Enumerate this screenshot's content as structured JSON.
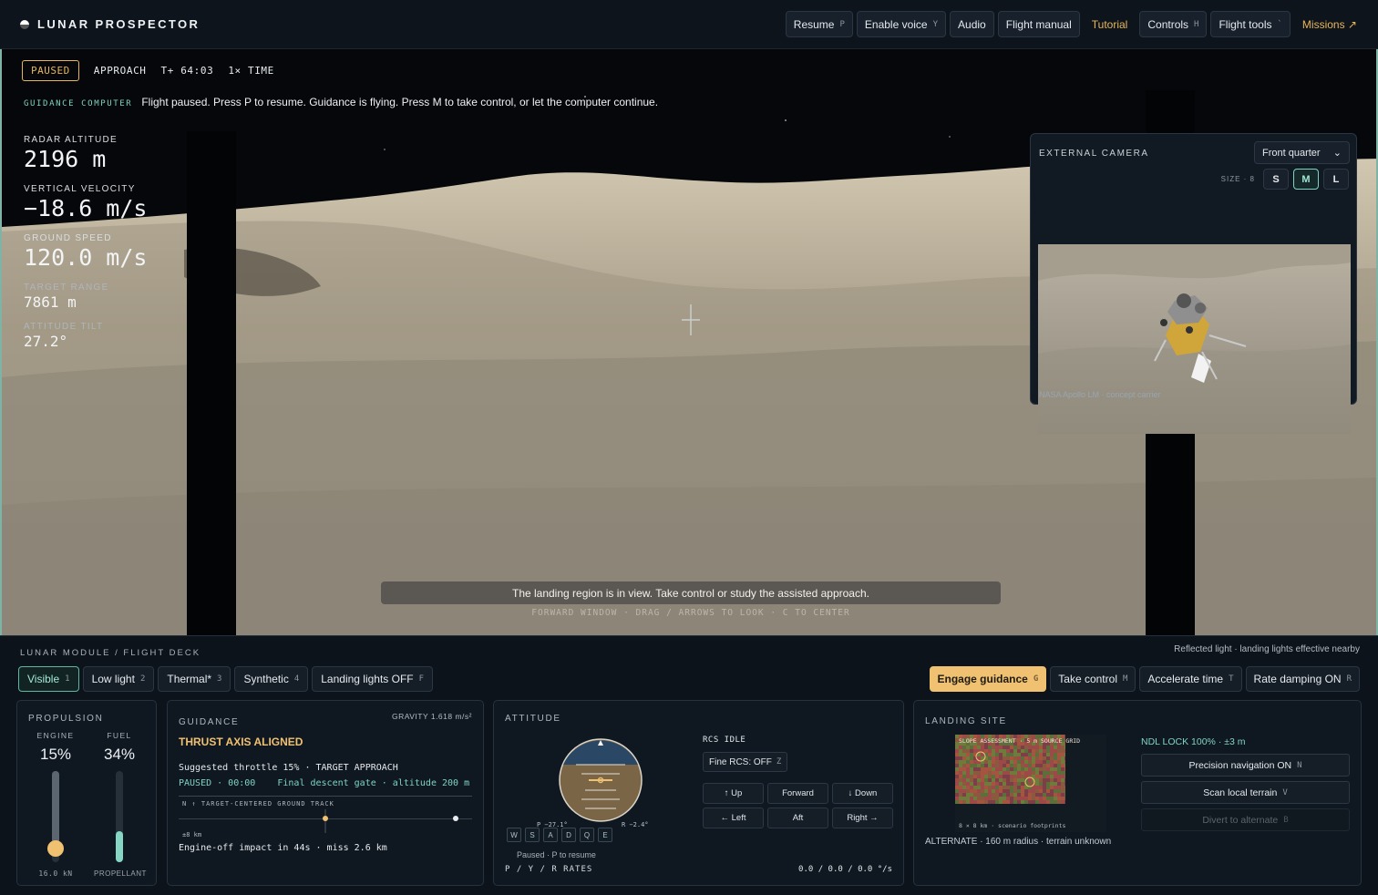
{
  "app": {
    "title": "LUNAR PROSPECTOR"
  },
  "topnav": [
    {
      "label": "Resume",
      "key": "P"
    },
    {
      "label": "Enable voice",
      "key": "Y"
    },
    {
      "label": "Audio",
      "key": ""
    },
    {
      "label": "Flight manual",
      "key": ""
    },
    {
      "label": "Tutorial",
      "key": ""
    },
    {
      "label": "Controls",
      "key": "H"
    },
    {
      "label": "Flight tools",
      "key": "`"
    },
    {
      "label": "Missions ↗",
      "key": ""
    }
  ],
  "status": {
    "badge": "PAUSED",
    "phase": "APPROACH",
    "met": "T+ 64:03",
    "timewarp": "1× TIME"
  },
  "guidance_msg": {
    "label": "GUIDANCE COMPUTER",
    "text": "Flight paused. Press P to resume. Guidance is flying. Press M to take control, or let the computer continue."
  },
  "telemetry": [
    {
      "label": "RADAR ALTITUDE",
      "value": "2196 m"
    },
    {
      "label": "VERTICAL VELOCITY",
      "value": "−18.6 m/s"
    },
    {
      "label": "GROUND SPEED",
      "value": "120.0 m/s"
    },
    {
      "label": "TARGET RANGE",
      "value": "7861 m"
    },
    {
      "label": "ATTITUDE TILT",
      "value": "27.2°"
    }
  ],
  "viewport": {
    "toast": "The landing region is in view. Take control or study the assisted approach.",
    "hint": "FORWARD WINDOW · DRAG / ARROWS TO LOOK · C TO CENTER"
  },
  "external_camera": {
    "title": "EXTERNAL CAMERA",
    "view_selected": "Front quarter",
    "size_label": "SIZE · 8",
    "sizes": [
      "S",
      "M",
      "L"
    ],
    "size_active": "M",
    "caption": "NASA Apollo LM · concept carrier"
  },
  "deck": {
    "title": "LUNAR MODULE / FLIGHT DECK",
    "note": "Reflected light · landing lights effective nearby",
    "view_modes": [
      {
        "label": "Visible",
        "key": "1",
        "active": true
      },
      {
        "label": "Low light",
        "key": "2",
        "active": false
      },
      {
        "label": "Thermal*",
        "key": "3",
        "active": false
      },
      {
        "label": "Synthetic",
        "key": "4",
        "active": false
      },
      {
        "label": "Landing lights OFF",
        "key": "F",
        "active": false
      }
    ],
    "actions": [
      {
        "label": "Engage guidance",
        "key": "G"
      },
      {
        "label": "Take control",
        "key": "M"
      },
      {
        "label": "Accelerate time",
        "key": "T"
      },
      {
        "label": "Rate damping ON",
        "key": "R"
      }
    ]
  },
  "propulsion": {
    "title": "PROPULSION",
    "engine_label": "ENGINE",
    "engine_value": "15%",
    "engine_level": 0.15,
    "engine_foot": "16.0 kN",
    "fuel_label": "FUEL",
    "fuel_value": "34%",
    "fuel_level": 0.34,
    "fuel_foot": "PROPELLANT"
  },
  "guidance": {
    "title": "GUIDANCE",
    "gravity": "GRAVITY 1.618 m/s²",
    "status": "THRUST AXIS ALIGNED",
    "suggested": "Suggested throttle 15% · TARGET APPROACH",
    "gate": "PAUSED · 00:00    Final descent gate · altitude 200 m",
    "track_label": "N ↑   TARGET-CENTERED GROUND TRACK",
    "track_scale": "±8 km",
    "impact": "Engine-off impact in 44s · miss 2.6 km"
  },
  "attitude": {
    "title": "ATTITUDE",
    "pitch": "P −27.1°",
    "roll": "R −2.4°",
    "keys": [
      "W",
      "S",
      "A",
      "D",
      "Q",
      "E"
    ],
    "paused_note": "Paused · P to resume",
    "rates_label": "P / Y / R RATES",
    "rates_value": "0.0 / 0.0 / 0.0 °/s",
    "rcs_status": "RCS IDLE",
    "fine_rcs": "Fine RCS: OFF",
    "fine_rcs_key": "Z",
    "rcs_buttons": [
      "↑ Up",
      "Forward",
      "↓ Down",
      "← Left",
      "Aft",
      "Right →"
    ]
  },
  "landing_site": {
    "title": "LANDING SITE",
    "slope_title": "SLOPE ASSESSMENT · 5 m SOURCE GRID",
    "slope_foot": "8 × 8 km · scenario footprints",
    "alternate": "ALTERNATE · 160 m radius · terrain unknown",
    "ndl": "NDL LOCK 100% · ±3 m",
    "buttons": [
      {
        "label": "Precision navigation ON",
        "key": "N",
        "disabled": false
      },
      {
        "label": "Scan local terrain",
        "key": "V",
        "disabled": false
      },
      {
        "label": "Divert to alternate",
        "key": "B",
        "disabled": true
      }
    ]
  },
  "colors": {
    "accent": "#7fd3c0",
    "warning": "#f0c171",
    "background": "#0d131a"
  }
}
